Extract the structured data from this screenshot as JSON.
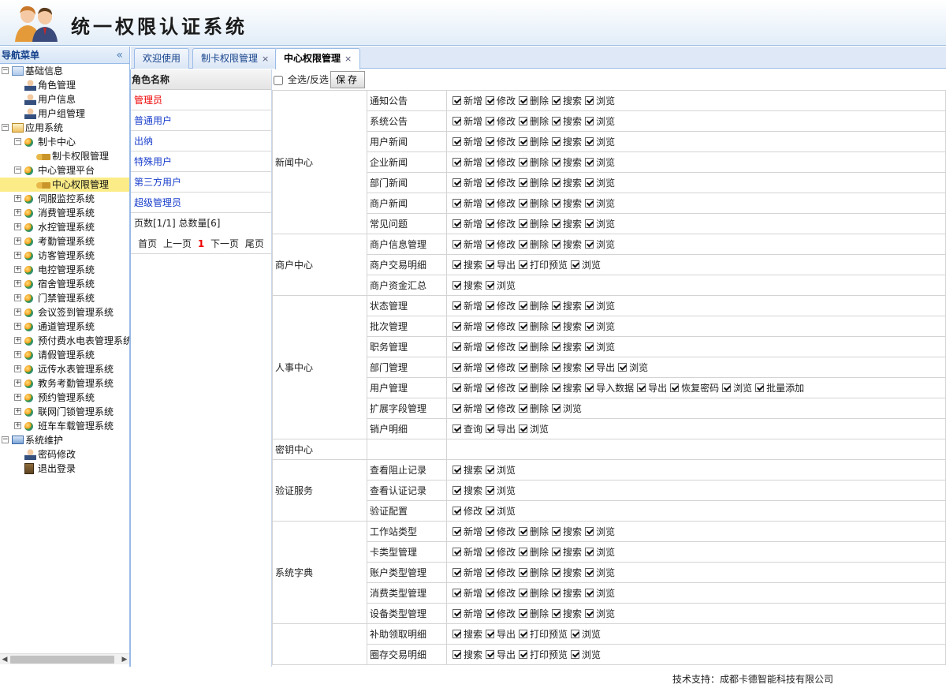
{
  "header": {
    "title": "统一权限认证系统"
  },
  "sidebar": {
    "title": "导航菜单",
    "tree": [
      {
        "label": "基础信息",
        "icon": "folder-icon",
        "toggle": "−",
        "depth": 0
      },
      {
        "label": "角色管理",
        "icon": "role-icon",
        "depth": 1
      },
      {
        "label": "用户信息",
        "icon": "user-icon",
        "depth": 1
      },
      {
        "label": "用户组管理",
        "icon": "user-group-icon",
        "depth": 1
      },
      {
        "label": "应用系统",
        "icon": "home-icon",
        "toggle": "−",
        "depth": 0
      },
      {
        "label": "制卡中心",
        "icon": "globe-icon",
        "toggle": "−",
        "depth": 1
      },
      {
        "label": "制卡权限管理",
        "icon": "key-icon",
        "depth": 2
      },
      {
        "label": "中心管理平台",
        "icon": "globe-icon",
        "toggle": "−",
        "depth": 1
      },
      {
        "label": "中心权限管理",
        "icon": "key-icon",
        "depth": 2,
        "selected": true
      },
      {
        "label": "伺服监控系统",
        "icon": "globe-icon",
        "toggle": "+",
        "depth": 1
      },
      {
        "label": "消费管理系统",
        "icon": "globe-icon",
        "toggle": "+",
        "depth": 1
      },
      {
        "label": "水控管理系统",
        "icon": "globe-icon",
        "toggle": "+",
        "depth": 1
      },
      {
        "label": "考勤管理系统",
        "icon": "globe-icon",
        "toggle": "+",
        "depth": 1
      },
      {
        "label": "访客管理系统",
        "icon": "globe-icon",
        "toggle": "+",
        "depth": 1
      },
      {
        "label": "电控管理系统",
        "icon": "globe-icon",
        "toggle": "+",
        "depth": 1
      },
      {
        "label": "宿舍管理系统",
        "icon": "globe-icon",
        "toggle": "+",
        "depth": 1
      },
      {
        "label": "门禁管理系统",
        "icon": "globe-icon",
        "toggle": "+",
        "depth": 1
      },
      {
        "label": "会议签到管理系统",
        "icon": "globe-icon",
        "toggle": "+",
        "depth": 1
      },
      {
        "label": "通道管理系统",
        "icon": "globe-icon",
        "toggle": "+",
        "depth": 1
      },
      {
        "label": "预付费水电表管理系统",
        "icon": "globe-icon",
        "toggle": "+",
        "depth": 1
      },
      {
        "label": "请假管理系统",
        "icon": "globe-icon",
        "toggle": "+",
        "depth": 1
      },
      {
        "label": "远传水表管理系统",
        "icon": "globe-icon",
        "toggle": "+",
        "depth": 1
      },
      {
        "label": "教务考勤管理系统",
        "icon": "globe-icon",
        "toggle": "+",
        "depth": 1
      },
      {
        "label": "预约管理系统",
        "icon": "globe-icon",
        "toggle": "+",
        "depth": 1
      },
      {
        "label": "联网门锁管理系统",
        "icon": "globe-icon",
        "toggle": "+",
        "depth": 1
      },
      {
        "label": "班车车载管理系统",
        "icon": "globe-icon",
        "toggle": "+",
        "depth": 1
      },
      {
        "label": "系统维护",
        "icon": "computer-icon",
        "toggle": "−",
        "depth": 0
      },
      {
        "label": "密码修改",
        "icon": "password-icon",
        "depth": 1
      },
      {
        "label": "退出登录",
        "icon": "logout-icon",
        "depth": 1
      }
    ]
  },
  "tabs": [
    {
      "label": "欢迎使用",
      "closable": false,
      "active": false
    },
    {
      "label": "制卡权限管理",
      "closable": true,
      "active": false
    },
    {
      "label": "中心权限管理",
      "closable": true,
      "active": true
    }
  ],
  "roles": {
    "header": "角色名称",
    "items": [
      "管理员",
      "普通用户",
      "出纳",
      "特殊用户",
      "第三方用户",
      "超级管理员"
    ],
    "selected_index": 0,
    "page_info": "页数[1/1]  总数量[6]",
    "pager": {
      "first": "首页",
      "prev": "上一页",
      "current": "1",
      "next": "下一页",
      "last": "尾页"
    }
  },
  "permissions": {
    "select_all_label": "全选/反选",
    "save_label": "保存",
    "groups": [
      {
        "name": "新闻中心",
        "modules": [
          {
            "name": "通知公告",
            "actions": [
              "新增",
              "修改",
              "删除",
              "搜索",
              "浏览"
            ]
          },
          {
            "name": "系统公告",
            "actions": [
              "新增",
              "修改",
              "删除",
              "搜索",
              "浏览"
            ]
          },
          {
            "name": "用户新闻",
            "actions": [
              "新增",
              "修改",
              "删除",
              "搜索",
              "浏览"
            ]
          },
          {
            "name": "企业新闻",
            "actions": [
              "新增",
              "修改",
              "删除",
              "搜索",
              "浏览"
            ]
          },
          {
            "name": "部门新闻",
            "actions": [
              "新增",
              "修改",
              "删除",
              "搜索",
              "浏览"
            ]
          },
          {
            "name": "商户新闻",
            "actions": [
              "新增",
              "修改",
              "删除",
              "搜索",
              "浏览"
            ]
          },
          {
            "name": "常见问题",
            "actions": [
              "新增",
              "修改",
              "删除",
              "搜索",
              "浏览"
            ]
          }
        ]
      },
      {
        "name": "商户中心",
        "modules": [
          {
            "name": "商户信息管理",
            "actions": [
              "新增",
              "修改",
              "删除",
              "搜索",
              "浏览"
            ]
          },
          {
            "name": "商户交易明细",
            "actions": [
              "搜索",
              "导出",
              "打印预览",
              "浏览"
            ]
          },
          {
            "name": "商户资金汇总",
            "actions": [
              "搜索",
              "浏览"
            ]
          }
        ]
      },
      {
        "name": "人事中心",
        "modules": [
          {
            "name": "状态管理",
            "actions": [
              "新增",
              "修改",
              "删除",
              "搜索",
              "浏览"
            ]
          },
          {
            "name": "批次管理",
            "actions": [
              "新增",
              "修改",
              "删除",
              "搜索",
              "浏览"
            ]
          },
          {
            "name": "职务管理",
            "actions": [
              "新增",
              "修改",
              "删除",
              "搜索",
              "浏览"
            ]
          },
          {
            "name": "部门管理",
            "actions": [
              "新增",
              "修改",
              "删除",
              "搜索",
              "导出",
              "浏览"
            ]
          },
          {
            "name": "用户管理",
            "actions": [
              "新增",
              "修改",
              "删除",
              "搜索",
              "导入数据",
              "导出",
              "恢复密码",
              "浏览",
              "批量添加"
            ]
          },
          {
            "name": "扩展字段管理",
            "actions": [
              "新增",
              "修改",
              "删除",
              "浏览"
            ]
          },
          {
            "name": "销户明细",
            "actions": [
              "查询",
              "导出",
              "浏览"
            ]
          }
        ]
      },
      {
        "name": "密钥中心",
        "modules": [
          {
            "name": "",
            "actions": []
          }
        ]
      },
      {
        "name": "验证服务",
        "modules": [
          {
            "name": "查看阻止记录",
            "actions": [
              "搜索",
              "浏览"
            ]
          },
          {
            "name": "查看认证记录",
            "actions": [
              "搜索",
              "浏览"
            ]
          },
          {
            "name": "验证配置",
            "actions": [
              "修改",
              "浏览"
            ]
          }
        ]
      },
      {
        "name": "系统字典",
        "modules": [
          {
            "name": "工作站类型",
            "actions": [
              "新增",
              "修改",
              "删除",
              "搜索",
              "浏览"
            ]
          },
          {
            "name": "卡类型管理",
            "actions": [
              "新增",
              "修改",
              "删除",
              "搜索",
              "浏览"
            ]
          },
          {
            "name": "账户类型管理",
            "actions": [
              "新增",
              "修改",
              "删除",
              "搜索",
              "浏览"
            ]
          },
          {
            "name": "消费类型管理",
            "actions": [
              "新增",
              "修改",
              "删除",
              "搜索",
              "浏览"
            ]
          },
          {
            "name": "设备类型管理",
            "actions": [
              "新增",
              "修改",
              "删除",
              "搜索",
              "浏览"
            ]
          }
        ]
      },
      {
        "name": "",
        "modules": [
          {
            "name": "补助领取明细",
            "actions": [
              "搜索",
              "导出",
              "打印预览",
              "浏览"
            ]
          },
          {
            "name": "圈存交易明细",
            "actions": [
              "搜索",
              "导出",
              "打印预览",
              "浏览"
            ]
          }
        ]
      }
    ]
  },
  "footer": {
    "text": "技术支持：成都卡德智能科技有限公司"
  }
}
